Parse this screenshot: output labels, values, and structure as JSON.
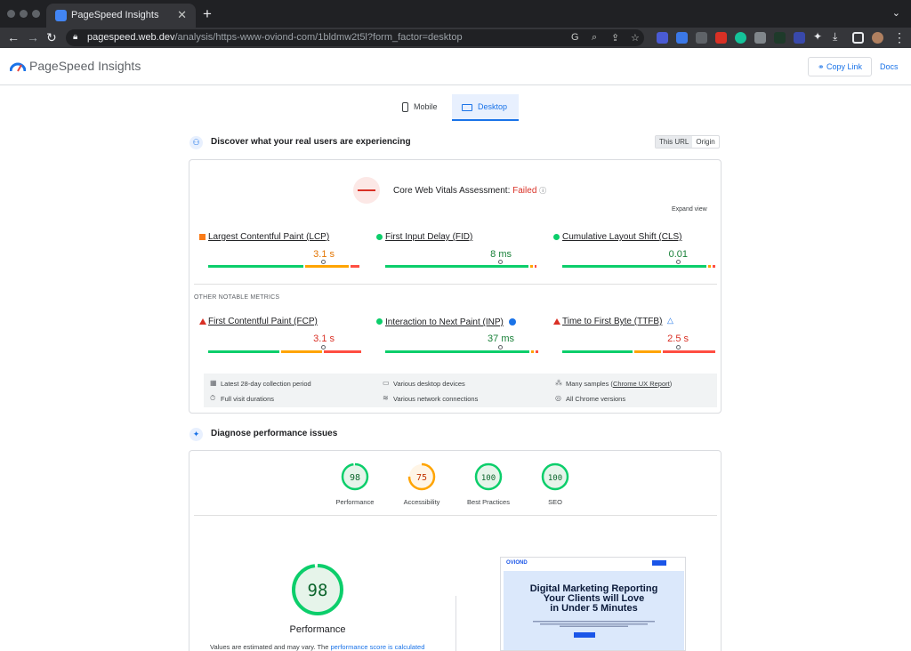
{
  "browser": {
    "tab_title": "PageSpeed Insights",
    "url_host": "pagespeed.web.dev",
    "url_path": "/analysis/https-www-oviond-com/1bldmw2t5l?form_factor=desktop"
  },
  "header": {
    "logo_text": "PageSpeed Insights",
    "copy_link": "Copy Link",
    "docs": "Docs"
  },
  "device_tabs": {
    "mobile": "Mobile",
    "desktop": "Desktop",
    "active": "desktop"
  },
  "real_users": {
    "title": "Discover what your real users are experiencing",
    "toggle_url": "This URL",
    "toggle_origin": "Origin",
    "assessment_prefix": "Core Web Vitals Assessment:",
    "assessment_status": "Failed",
    "expand_view": "Expand view",
    "other_label": "OTHER NOTABLE METRICS",
    "metrics": [
      {
        "name": "Largest Contentful Paint (LCP)",
        "value": "3.1 s",
        "status": "average"
      },
      {
        "name": "First Input Delay (FID)",
        "value": "8 ms",
        "status": "good"
      },
      {
        "name": "Cumulative Layout Shift (CLS)",
        "value": "0.01",
        "status": "good"
      }
    ],
    "other_metrics": [
      {
        "name": "First Contentful Paint (FCP)",
        "value": "3.1 s",
        "status": "poor"
      },
      {
        "name": "Interaction to Next Paint (INP)",
        "value": "37 ms",
        "status": "good"
      },
      {
        "name": "Time to First Byte (TTFB)",
        "value": "2.5 s",
        "status": "poor"
      }
    ],
    "info": {
      "collection": "Latest 28-day collection period",
      "devices": "Various desktop devices",
      "samples_prefix": "Many samples (",
      "samples_link": "Chrome UX Report",
      "samples_suffix": ")",
      "durations": "Full visit durations",
      "network": "Various network connections",
      "versions": "All Chrome versions"
    }
  },
  "diagnose": {
    "title": "Diagnose performance issues",
    "scores": [
      {
        "label": "Performance",
        "score": "98",
        "color": "#0cce6b"
      },
      {
        "label": "Accessibility",
        "score": "75",
        "color": "#ffa400"
      },
      {
        "label": "Best Practices",
        "score": "100",
        "color": "#0cce6b"
      },
      {
        "label": "SEO",
        "score": "100",
        "color": "#0cce6b"
      }
    ],
    "big_score": "98",
    "big_label": "Performance",
    "note_text": "Values are estimated and may vary. The",
    "note_link": "performance score is calculated"
  },
  "thumbnail": {
    "brand": "OVIOND",
    "headline_1": "Digital Marketing Reporting",
    "headline_2": "Your Clients will Love",
    "headline_3": "in Under 5 Minutes"
  },
  "colors": {
    "good": "#0cce6b",
    "average": "#ffa400",
    "poor": "#ff4e42",
    "accent": "#1a73e8"
  }
}
